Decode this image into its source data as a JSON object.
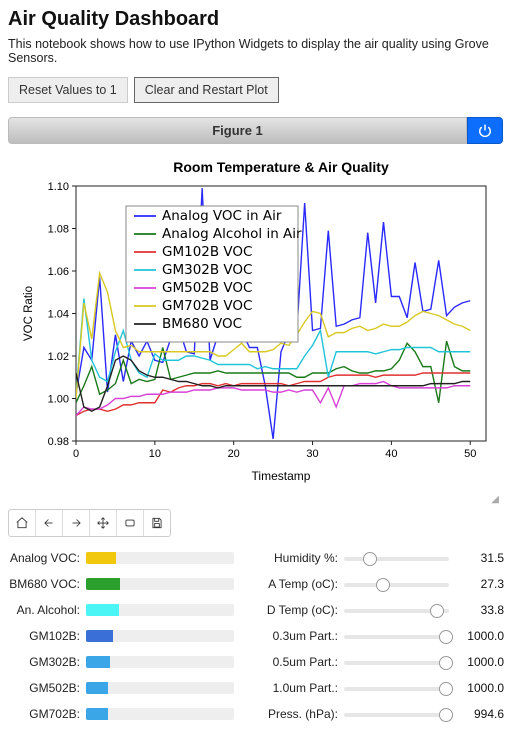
{
  "title": "Air Quality Dashboard",
  "description": "This notebook shows how to use IPython Widgets to display the air quality using Grove Sensors.",
  "buttons": {
    "reset": "Reset Values to 1",
    "clear": "Clear and Restart Plot"
  },
  "figure_bar": {
    "title": "Figure 1"
  },
  "chart_data": {
    "type": "line",
    "title": "Room Temperature & Air Quality",
    "xlabel": "Timestamp",
    "ylabel": "VOC Ratio",
    "xlim": [
      0,
      52
    ],
    "ylim": [
      0.98,
      1.1
    ],
    "xticks": [
      0,
      10,
      20,
      30,
      40,
      50
    ],
    "yticks": [
      0.98,
      1.0,
      1.02,
      1.04,
      1.06,
      1.08,
      1.1
    ],
    "series": [
      {
        "name": "Analog VOC in Air",
        "color": "#2a2aff",
        "values": [
          1.002,
          1.024,
          1.018,
          1.057,
          1.003,
          1.03,
          1.008,
          1.027,
          1.02,
          1.027,
          1.018,
          1.017,
          1.028,
          1.034,
          1.022,
          1.021,
          1.099,
          1.018,
          1.03,
          1.031,
          1.028,
          1.032,
          1.024,
          1.024,
          1.006,
          0.981,
          1.022,
          1.031,
          1.031,
          1.092,
          1.032,
          1.033,
          1.079,
          1.034,
          1.035,
          1.037,
          1.038,
          1.078,
          1.045,
          1.083,
          1.048,
          1.048,
          1.038,
          1.064,
          1.041,
          1.042,
          1.065,
          1.039,
          1.043,
          1.045,
          1.046
        ]
      },
      {
        "name": "Analog Alcohol in Air",
        "color": "#1a7a1a",
        "values": [
          0.998,
          1.006,
          1.015,
          1.002,
          1.004,
          1.007,
          1.018,
          1.007,
          1.009,
          1.008,
          1.009,
          1.024,
          1.009,
          1.01,
          1.011,
          1.012,
          1.012,
          1.012,
          1.013,
          1.012,
          1.012,
          1.012,
          1.012,
          1.012,
          1.012,
          1.012,
          1.012,
          1.012,
          1.01,
          1.01,
          1.012,
          1.012,
          1.012,
          1.014,
          1.015,
          1.013,
          1.012,
          1.012,
          1.013,
          1.013,
          1.014,
          1.018,
          1.026,
          1.022,
          1.015,
          1.015,
          0.998,
          1.027,
          1.015,
          1.013,
          1.013
        ]
      },
      {
        "name": "GM102B VOC",
        "color": "#e03030",
        "values": [
          0.992,
          0.994,
          0.995,
          0.995,
          0.994,
          0.995,
          0.997,
          0.997,
          0.998,
          0.998,
          0.998,
          1.004,
          1.003,
          1.005,
          1.006,
          1.006,
          1.007,
          1.007,
          1.006,
          1.007,
          1.006,
          1.007,
          1.007,
          1.007,
          1.007,
          1.007,
          1.007,
          1.006,
          1.007,
          1.008,
          1.008,
          1.008,
          1.01,
          1.011,
          1.011,
          1.011,
          1.011,
          1.011,
          1.01,
          1.011,
          1.011,
          1.011,
          1.011,
          1.011,
          1.012,
          1.012,
          1.012,
          1.012,
          1.012,
          1.012,
          1.012
        ]
      },
      {
        "name": "GM302B VOC",
        "color": "#20c4d8",
        "values": [
          1.002,
          1.047,
          1.018,
          1.01,
          1.008,
          1.022,
          1.032,
          1.018,
          1.012,
          1.01,
          1.021,
          1.018,
          1.018,
          1.018,
          1.02,
          1.02,
          1.019,
          1.018,
          1.016,
          1.016,
          1.016,
          1.016,
          1.016,
          1.014,
          1.015,
          1.014,
          1.014,
          1.014,
          1.014,
          1.02,
          1.025,
          1.032,
          1.01,
          1.022,
          1.022,
          1.022,
          1.022,
          1.022,
          1.021,
          1.022,
          1.023,
          1.023,
          1.024,
          1.024,
          1.024,
          1.024,
          1.022,
          1.022,
          1.022,
          1.022,
          1.022
        ]
      },
      {
        "name": "GM502B VOC",
        "color": "#d840d8",
        "values": [
          0.992,
          0.996,
          0.995,
          0.995,
          0.997,
          1.0,
          1.0,
          1.001,
          1.001,
          1.002,
          1.002,
          1.002,
          1.003,
          1.003,
          1.003,
          1.004,
          1.004,
          1.004,
          1.005,
          1.005,
          1.005,
          1.004,
          1.004,
          1.004,
          1.004,
          1.003,
          1.003,
          1.004,
          1.003,
          1.004,
          1.004,
          0.998,
          1.005,
          0.996,
          1.006,
          1.006,
          1.007,
          1.007,
          1.007,
          1.008,
          1.006,
          1.005,
          1.005,
          1.005,
          1.005,
          1.005,
          1.005,
          1.005,
          1.006,
          1.006,
          1.006
        ]
      },
      {
        "name": "GM702B VOC",
        "color": "#d8c820",
        "values": [
          1.0,
          1.045,
          1.028,
          1.059,
          1.05,
          1.032,
          1.024,
          1.025,
          1.022,
          1.022,
          1.022,
          1.022,
          1.022,
          1.022,
          1.022,
          1.022,
          1.022,
          1.022,
          1.02,
          1.02,
          1.023,
          1.026,
          1.022,
          1.022,
          1.022,
          1.023,
          1.026,
          1.025,
          1.03,
          1.036,
          1.041,
          1.04,
          1.029,
          1.031,
          1.031,
          1.033,
          1.034,
          1.032,
          1.033,
          1.035,
          1.034,
          1.034,
          1.036,
          1.039,
          1.041,
          1.04,
          1.039,
          1.037,
          1.035,
          1.034,
          1.032
        ]
      },
      {
        "name": "BM680 VOC",
        "color": "#222222",
        "values": [
          1.012,
          0.996,
          0.994,
          0.996,
          1.006,
          1.018,
          1.02,
          1.018,
          1.013,
          1.011,
          1.01,
          1.01,
          1.009,
          1.008,
          1.008,
          1.007,
          1.006,
          1.006,
          1.005,
          1.006,
          1.006,
          1.006,
          1.006,
          1.006,
          1.006,
          1.006,
          1.006,
          1.006,
          1.006,
          1.006,
          1.006,
          1.006,
          1.006,
          1.006,
          1.006,
          1.006,
          1.006,
          1.006,
          1.006,
          1.006,
          1.006,
          1.006,
          1.006,
          1.006,
          1.006,
          1.007,
          1.007,
          1.007,
          1.007,
          1.008,
          1.008
        ]
      }
    ]
  },
  "toolbar_icons": [
    "home",
    "back",
    "forward",
    "pan",
    "zoom",
    "save"
  ],
  "left_widgets": [
    {
      "label": "Analog VOC:",
      "value": 0.2,
      "color": "#f2c80f"
    },
    {
      "label": "BM680 VOC:",
      "value": 0.23,
      "color": "#2ca02c"
    },
    {
      "label": "An. Alcohol:",
      "value": 0.22,
      "color": "#4cf5f5"
    },
    {
      "label": "GM102B:",
      "value": 0.18,
      "color": "#3a6fd8"
    },
    {
      "label": "GM302B:",
      "value": 0.16,
      "color": "#3aa6e8"
    },
    {
      "label": "GM502B:",
      "value": 0.15,
      "color": "#3aa6e8"
    },
    {
      "label": "GM702B:",
      "value": 0.15,
      "color": "#3aa6e8"
    }
  ],
  "right_widgets": [
    {
      "label": "Humidity %:",
      "value": "31.5",
      "pos": 0.18
    },
    {
      "label": "A Temp (oC):",
      "value": "27.3",
      "pos": 0.3
    },
    {
      "label": "D Temp (oC):",
      "value": "33.8",
      "pos": 0.82
    },
    {
      "label": "0.3um Part.:",
      "value": "1000.0",
      "pos": 0.9
    },
    {
      "label": "0.5um Part.:",
      "value": "1000.0",
      "pos": 0.9
    },
    {
      "label": "1.0um Part.:",
      "value": "1000.0",
      "pos": 0.9
    },
    {
      "label": "Press. (hPa):",
      "value": "994.6",
      "pos": 0.9
    }
  ]
}
